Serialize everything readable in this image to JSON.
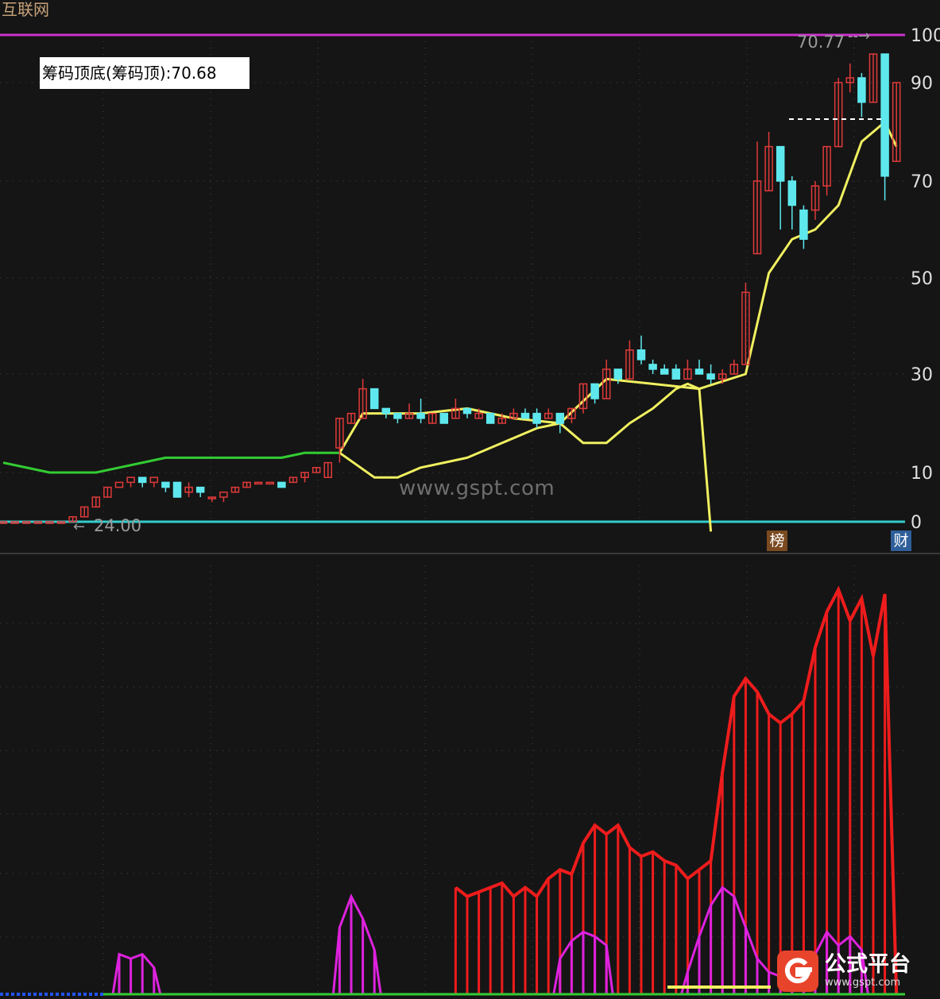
{
  "header": {
    "sector_name": "互联网"
  },
  "indicator": {
    "label": "筹码顶底(筹码顶):70.68"
  },
  "price_axis": {
    "ticks": [
      "100",
      "90",
      "70",
      "50",
      "30",
      "10",
      "0"
    ]
  },
  "annotations": {
    "high_label": "70.77",
    "low_label": "24.00"
  },
  "tags": {
    "list": "榜",
    "finance": "财"
  },
  "watermark": {
    "text": "www.gspt.com"
  },
  "logo": {
    "name": "公式平台",
    "url": "www.gspt.com"
  },
  "colors": {
    "background": "#151515",
    "up": "#e03a3a",
    "down": "#5ee8ee",
    "top_line": "#cc33cc",
    "zero_line": "#33cccc",
    "green_line": "#33cc33",
    "yellow_line": "#f0f060",
    "hist_red": "#ee1c1c",
    "hist_magenta": "#dd22dd"
  },
  "chart_data": {
    "type": "candlestick",
    "y_axis_ticks": [
      100,
      90,
      70,
      50,
      30,
      10,
      0
    ],
    "candles": [
      [
        0,
        0,
        0,
        0
      ],
      [
        0,
        0,
        0,
        0
      ],
      [
        0,
        0,
        0,
        0
      ],
      [
        0,
        0,
        0,
        0
      ],
      [
        0,
        0,
        0,
        0
      ],
      [
        0,
        0,
        0,
        0
      ],
      [
        0,
        1,
        0,
        1
      ],
      [
        1,
        3,
        1,
        3
      ],
      [
        3,
        5,
        3,
        5
      ],
      [
        5,
        7,
        5,
        7
      ],
      [
        7,
        8,
        7,
        7
      ],
      [
        8,
        9,
        7,
        8
      ],
      [
        9,
        8,
        7,
        8
      ],
      [
        8,
        9,
        7,
        8
      ],
      [
        8,
        7,
        6,
        7
      ],
      [
        8,
        5,
        5,
        6
      ],
      [
        6,
        7,
        5,
        8
      ],
      [
        7,
        6,
        5,
        6
      ],
      [
        5,
        5,
        4,
        5
      ],
      [
        5,
        6,
        4,
        5
      ],
      [
        6,
        7,
        6,
        7
      ],
      [
        7,
        8,
        7,
        8
      ],
      [
        8,
        8,
        8,
        8
      ],
      [
        8,
        8,
        8,
        8
      ],
      [
        8,
        7,
        7,
        8
      ],
      [
        8,
        9,
        8,
        9
      ],
      [
        9,
        10,
        8,
        10
      ],
      [
        10,
        11,
        10,
        11
      ],
      [
        9,
        12,
        9,
        12
      ],
      [
        15,
        21,
        12,
        21
      ],
      [
        20,
        22,
        20,
        22
      ],
      [
        21,
        27,
        21,
        29
      ],
      [
        27,
        23,
        23,
        27
      ],
      [
        23,
        22,
        21,
        23
      ],
      [
        22,
        21,
        20,
        22
      ],
      [
        21,
        22,
        21,
        24
      ],
      [
        22,
        21,
        20,
        25
      ],
      [
        20,
        22,
        20,
        22
      ],
      [
        22,
        20,
        20,
        22
      ],
      [
        21,
        23,
        21,
        25
      ],
      [
        23,
        22,
        21,
        23
      ],
      [
        21,
        22,
        21,
        23
      ],
      [
        22,
        20,
        20,
        22
      ],
      [
        20,
        21,
        20,
        22
      ],
      [
        21,
        22,
        21,
        23
      ],
      [
        22,
        21,
        21,
        23
      ],
      [
        22,
        20,
        19,
        23
      ],
      [
        21,
        22,
        21,
        23
      ],
      [
        22,
        20,
        18,
        22
      ],
      [
        21,
        23,
        20,
        23
      ],
      [
        23,
        28,
        22,
        28
      ],
      [
        28,
        25,
        24,
        28
      ],
      [
        25,
        31,
        25,
        33
      ],
      [
        31,
        29,
        28,
        31
      ],
      [
        29,
        35,
        29,
        37
      ],
      [
        35,
        33,
        32,
        38
      ],
      [
        32,
        31,
        30,
        33
      ],
      [
        31,
        30,
        30,
        32
      ],
      [
        31,
        29,
        29,
        32
      ],
      [
        29,
        31,
        29,
        33
      ],
      [
        31,
        30,
        30,
        33
      ],
      [
        30,
        29,
        28,
        32
      ],
      [
        29,
        30,
        28,
        31
      ],
      [
        30,
        32,
        30,
        33
      ],
      [
        32,
        47,
        32,
        49
      ],
      [
        55,
        70,
        55,
        78
      ],
      [
        68,
        77,
        68,
        80
      ],
      [
        77,
        70,
        60,
        77
      ],
      [
        70,
        65,
        60,
        71
      ],
      [
        64,
        58,
        56,
        65
      ],
      [
        64,
        69,
        62,
        70
      ],
      [
        69,
        77,
        67,
        77
      ],
      [
        77,
        90,
        77,
        91
      ],
      [
        90,
        91,
        88,
        94
      ],
      [
        91,
        86,
        83,
        92
      ],
      [
        86,
        96,
        86,
        96
      ],
      [
        96,
        71,
        66,
        89
      ],
      [
        74,
        90,
        74,
        90
      ]
    ],
    "series": [
      {
        "name": "筹码顶",
        "color": "yellow",
        "x": [
          29,
          31,
          33,
          36,
          40,
          44,
          48,
          52,
          56,
          60,
          64,
          66,
          68,
          70,
          72,
          74,
          76,
          77
        ],
        "y": [
          14,
          22,
          22,
          22,
          23,
          21,
          20,
          29,
          28,
          27,
          30,
          51,
          58,
          60,
          65,
          78,
          82,
          77
        ]
      },
      {
        "x": [
          29,
          32,
          34,
          36,
          38,
          40,
          42,
          44,
          46,
          48,
          50,
          52,
          54,
          56,
          58,
          59,
          60,
          61
        ],
        "y": [
          14,
          9,
          9,
          11,
          12,
          13,
          15,
          17,
          19,
          20,
          16,
          16,
          20,
          23,
          27,
          28,
          27,
          -2
        ]
      },
      {
        "color": "green",
        "x": [
          0,
          4,
          8,
          10,
          12,
          14,
          16,
          20,
          24,
          26,
          28,
          29
        ],
        "y": [
          12,
          10,
          10,
          11,
          12,
          13,
          13,
          13,
          13,
          14,
          14,
          14
        ]
      }
    ],
    "histogram_red": {
      "x": [
        39,
        40,
        41,
        42,
        43,
        44,
        45,
        46,
        47,
        48,
        49,
        50,
        51,
        52,
        53,
        54,
        55,
        56,
        57,
        58,
        59,
        60,
        61,
        62,
        63,
        64,
        65,
        66,
        67,
        68,
        69,
        70,
        71,
        72,
        73,
        74,
        75,
        76,
        77
      ],
      "y": [
        0.24,
        0.22,
        0.23,
        0.24,
        0.25,
        0.22,
        0.24,
        0.22,
        0.26,
        0.28,
        0.27,
        0.34,
        0.38,
        0.36,
        0.38,
        0.33,
        0.31,
        0.32,
        0.3,
        0.29,
        0.26,
        0.28,
        0.3,
        0.5,
        0.67,
        0.71,
        0.68,
        0.63,
        0.61,
        0.63,
        0.66,
        0.78,
        0.86,
        0.91,
        0.84,
        0.89,
        0.76,
        0.9,
        0
      ]
    },
    "histogram_magenta": {
      "x": [
        10,
        11,
        12,
        13,
        29,
        30,
        31,
        32,
        48,
        49,
        50,
        51,
        52,
        59,
        60,
        61,
        62,
        63,
        64,
        65,
        66,
        67,
        68,
        69,
        70,
        71,
        72,
        73,
        74
      ],
      "y": [
        0.09,
        0.08,
        0.09,
        0.06,
        0.15,
        0.22,
        0.17,
        0.1,
        0.08,
        0.12,
        0.14,
        0.13,
        0.11,
        0.05,
        0.13,
        0.2,
        0.24,
        0.22,
        0.15,
        0.08,
        0.05,
        0.04,
        0.05,
        0.07,
        0.09,
        0.14,
        0.11,
        0.13,
        0.1
      ]
    }
  }
}
